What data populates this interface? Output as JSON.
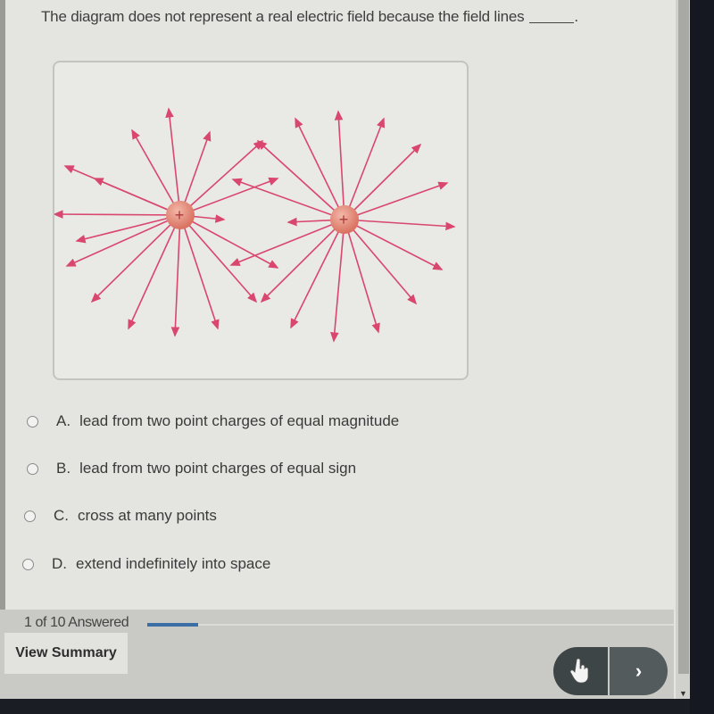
{
  "question": {
    "text": "The diagram does not represent a real electric field because the field lines",
    "blank_suffix": "."
  },
  "figure": {
    "description": "Field lines radiating from two positive point charges, with some lines crossing",
    "charges": [
      {
        "sign": "+",
        "label": "+"
      },
      {
        "sign": "+",
        "label": "+"
      }
    ],
    "line_color": "#d9466e",
    "charge_color": "#d9705f"
  },
  "options": [
    {
      "letter": "A.",
      "text": "lead from two point charges of equal magnitude",
      "selected": false
    },
    {
      "letter": "B.",
      "text": "lead from two point charges of equal sign",
      "selected": false
    },
    {
      "letter": "C.",
      "text": "cross at many points",
      "selected": false
    },
    {
      "letter": "D.",
      "text": "extend indefinitely into space",
      "selected": false
    }
  ],
  "footer": {
    "answered_text": "1 of 10 Answered",
    "progress_fraction": 0.1,
    "view_summary_label": "View Summary",
    "next_label": "›"
  },
  "colors": {
    "progress": "#3a6ea5",
    "nav_button": "#3d4547"
  }
}
